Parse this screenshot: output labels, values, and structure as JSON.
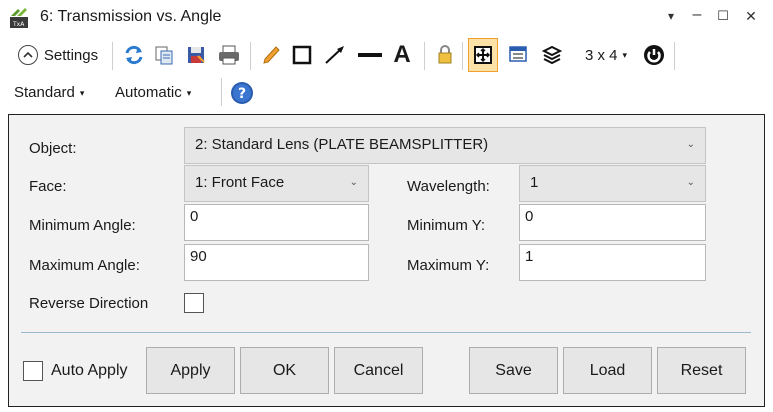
{
  "window": {
    "title": "6: Transmission vs. Angle",
    "controls": {
      "menu": "▾",
      "minimize": "–",
      "maximize": "☐",
      "close": "✕"
    }
  },
  "toolbar": {
    "settings_label": "Settings",
    "layout_label": "3 x 4",
    "text_tool_label": "A",
    "icons": [
      "refresh-icon",
      "copy-icon",
      "save-icon",
      "print-icon",
      "pencil-icon",
      "rectangle-icon",
      "arrow-icon",
      "line-icon",
      "text-icon",
      "lock-icon",
      "grid-toggle-icon",
      "window-icon",
      "layers-icon",
      "layout-icon",
      "power-icon"
    ]
  },
  "toolbar2": {
    "standard_label": "Standard",
    "automatic_label": "Automatic",
    "help_icon": "help-icon"
  },
  "form": {
    "object_label": "Object:",
    "object_value": "2: Standard Lens (PLATE BEAMSPLITTER)",
    "face_label": "Face:",
    "face_value": "1: Front Face",
    "wavelength_label": "Wavelength:",
    "wavelength_value": "1",
    "min_angle_label": "Minimum Angle:",
    "min_angle_value": "0",
    "min_y_label": "Minimum Y:",
    "min_y_value": "0",
    "max_angle_label": "Maximum Angle:",
    "max_angle_value": "90",
    "max_y_label": "Maximum Y:",
    "max_y_value": "1",
    "reverse_label": "Reverse Direction"
  },
  "footer": {
    "auto_apply_label": "Auto Apply",
    "apply_label": "Apply",
    "ok_label": "OK",
    "cancel_label": "Cancel",
    "save_label": "Save",
    "load_label": "Load",
    "reset_label": "Reset"
  },
  "colors": {
    "accent_orange": "#f0a030",
    "help_blue": "#2a5db0",
    "divider": "#9cb8cc",
    "panel_bg": "#f2f2f2"
  }
}
